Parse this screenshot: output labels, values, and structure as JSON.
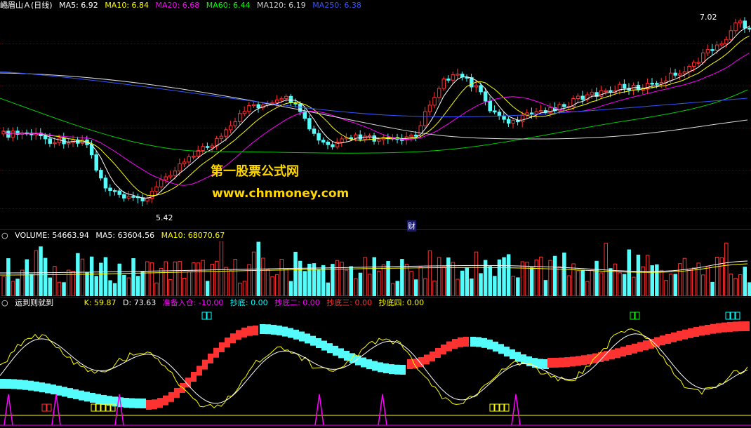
{
  "price_panel": {
    "title": "峨眉山Ａ(日线)",
    "indicators": [
      {
        "label": "MA5: 6.92",
        "color": "#ffffff"
      },
      {
        "label": "MA10: 6.84",
        "color": "#ffff00"
      },
      {
        "label": "MA20: 6.68",
        "color": "#ff00ff"
      },
      {
        "label": "MA60: 6.44",
        "color": "#00ff00"
      },
      {
        "label": "MA120: 6.19",
        "color": "#cccccc"
      },
      {
        "label": "MA250: 6.38",
        "color": "#3355ff"
      }
    ],
    "high_marker": "7.02",
    "low_marker": "5.42",
    "event_marker": "财",
    "watermark_line1": "第一股票公式网",
    "watermark_line2": "www.chnmoney.com"
  },
  "volume_panel": {
    "indicators": [
      {
        "label": "VOLUME: 54663.94",
        "color": "#ffffff"
      },
      {
        "label": "MA5: 63604.56",
        "color": "#ffffff"
      },
      {
        "label": "MA10: 68070.67",
        "color": "#ffff00"
      }
    ]
  },
  "custom_panel": {
    "title": "运到则就到",
    "indicators": [
      {
        "label": "K: 59.87",
        "color": "#ffff00"
      },
      {
        "label": "D: 73.63",
        "color": "#ffffff"
      },
      {
        "label": "准备入仓: -10.00",
        "color": "#ff00ff"
      },
      {
        "label": "抄底: 0.00",
        "color": "#00ffff"
      },
      {
        "label": "抄底二: 0.00",
        "color": "#ff00ff"
      },
      {
        "label": "抄底三: 0.00",
        "color": "#ff3333"
      },
      {
        "label": "抄底四: 0.00",
        "color": "#ffff00"
      }
    ]
  },
  "colors": {
    "up": "#ff3232",
    "down": "#54fcfc",
    "separator": "#8b0000"
  }
}
